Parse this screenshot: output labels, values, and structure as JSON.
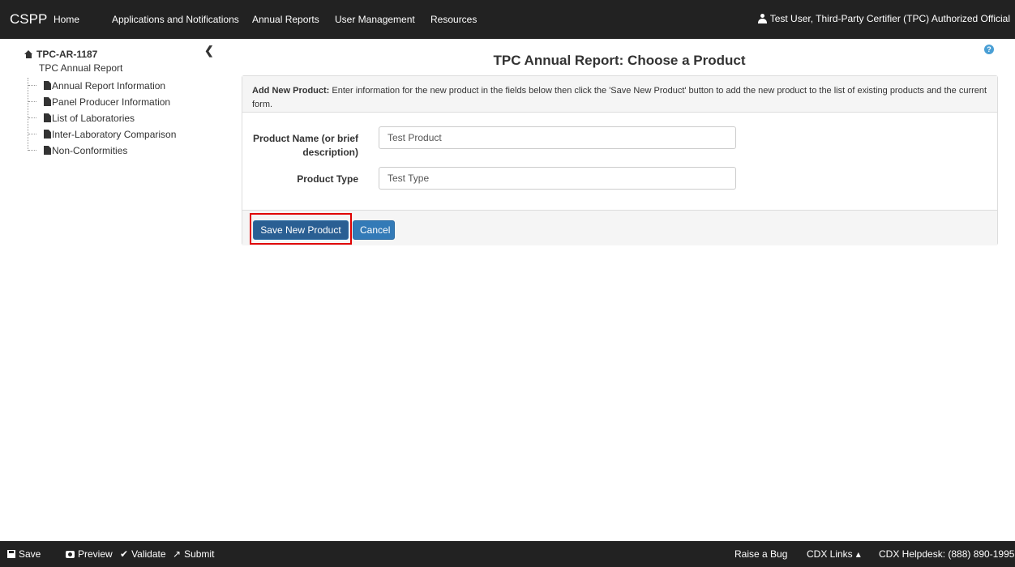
{
  "navbar": {
    "brand": "CSPP",
    "items": [
      "Home",
      "Applications and Notifications",
      "Annual Reports",
      "User Management",
      "Resources"
    ],
    "user": "Test User, Third-Party Certifier (TPC) Authorized Official"
  },
  "sidebar": {
    "collapse_glyph": "❮",
    "root_label": "TPC-AR-1187",
    "root_sub": "TPC Annual Report",
    "items": [
      {
        "label": "Annual Report Information"
      },
      {
        "label": "Panel Producer Information"
      },
      {
        "label": "List of Laboratories"
      },
      {
        "label": "Inter-Laboratory Comparison"
      },
      {
        "label": "Non-Conformities"
      }
    ]
  },
  "main": {
    "help_glyph": "?",
    "title": "TPC Annual Report: Choose a Product",
    "panel": {
      "heading_bold": "Add New Product:",
      "heading_text": " Enter information for the new product in the fields below then click the 'Save New Product' button to add the new product to the list of existing products and the current form.",
      "fields": [
        {
          "label_line1": "Product Name (or brief",
          "label_line2": "description)",
          "value": "Test Product"
        },
        {
          "label": "Product Type",
          "value": "Test Type"
        }
      ],
      "save_button": "Save New Product",
      "cancel_button": "Cancel"
    }
  },
  "footer": {
    "save": "Save",
    "preview": "Preview",
    "validate": "Validate",
    "submit": "Submit",
    "raise_bug": "Raise a Bug",
    "cdx_links": "CDX Links",
    "cdx_links_caret": "▴",
    "helpdesk": "CDX Helpdesk: (888) 890-1995",
    "validate_glyph": "✔",
    "submit_glyph": "↗"
  },
  "colors": {
    "navbar_bg": "#222222",
    "button_primary": "#337ab7",
    "highlight": "#e00000",
    "help_icon": "#4a9fd5"
  }
}
